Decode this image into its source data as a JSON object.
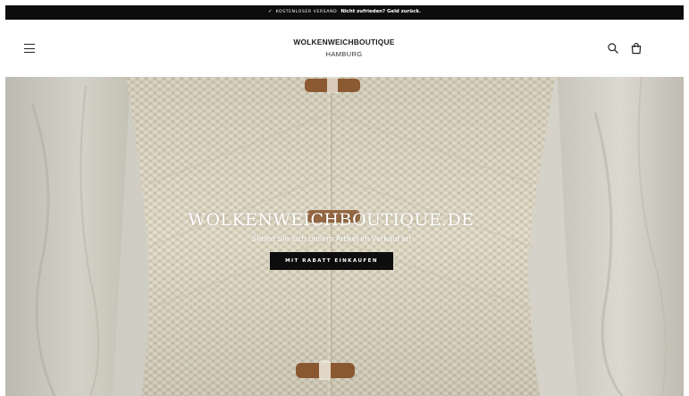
{
  "announcement": {
    "check_icon": "✓",
    "shipping": "Kostenloser Versand",
    "promise": "Nicht zufrieden? Geld zurück."
  },
  "header": {
    "brand": "WOLKENWEICHBOUTIQUE",
    "city": "HAMBURG",
    "icons": [
      "menu-icon",
      "search-icon",
      "cart-icon"
    ]
  },
  "hero": {
    "title": "WOLKENWEICHBOUTIQUE.DE",
    "subtitle": "Sehen Sie sich unsere Artikel im Verkauf an",
    "cta_label": "MIT RABATT EINKAUFEN"
  },
  "colors": {
    "announcement_bg": "#0d0d0d",
    "cta_bg": "#0d0d0d",
    "knit": "#d9d2c0",
    "shirt": "#ccc9bd",
    "toggle": "#8c5a32"
  }
}
